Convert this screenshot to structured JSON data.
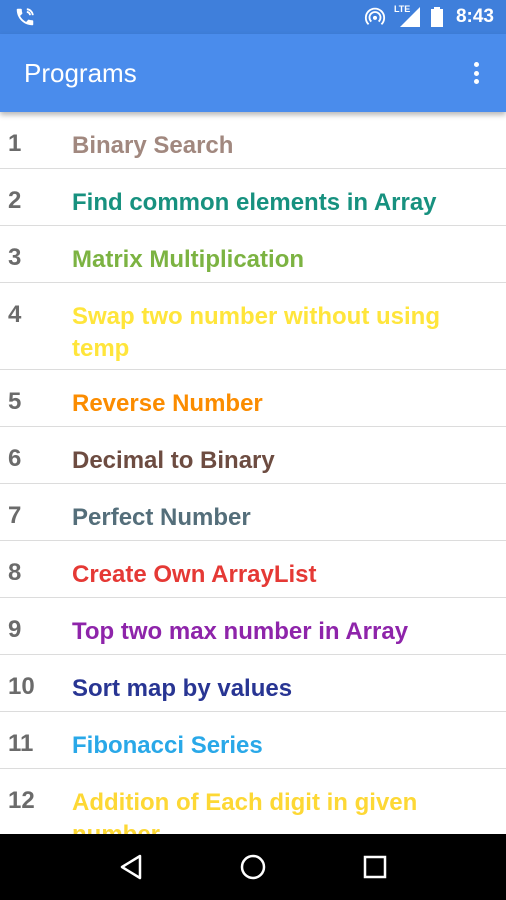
{
  "status_bar": {
    "time": "8:43",
    "network_label": "LTE"
  },
  "app_bar": {
    "title": "Programs",
    "overflow_icon": "more-vert-icon"
  },
  "programs": [
    {
      "num": "1",
      "title": "Binary Search",
      "color": "#A1887F"
    },
    {
      "num": "2",
      "title": "Find common elements in Array",
      "color": "#17917F"
    },
    {
      "num": "3",
      "title": "Matrix Multiplication",
      "color": "#7CB342"
    },
    {
      "num": "4",
      "title": "Swap two number without using temp",
      "color": "#FFE53B"
    },
    {
      "num": "5",
      "title": "Reverse Number",
      "color": "#FB8C00"
    },
    {
      "num": "6",
      "title": "Decimal to Binary",
      "color": "#6D4C41"
    },
    {
      "num": "7",
      "title": "Perfect Number",
      "color": "#546E7A"
    },
    {
      "num": "8",
      "title": "Create Own ArrayList",
      "color": "#E53935"
    },
    {
      "num": "9",
      "title": "Top two max number in Array",
      "color": "#8E24AA"
    },
    {
      "num": "10",
      "title": "Sort map by values",
      "color": "#283593"
    },
    {
      "num": "11",
      "title": "Fibonacci Series",
      "color": "#29A8E8"
    },
    {
      "num": "12",
      "title": "Addition of Each digit in given number",
      "color": "#FDD835"
    }
  ]
}
